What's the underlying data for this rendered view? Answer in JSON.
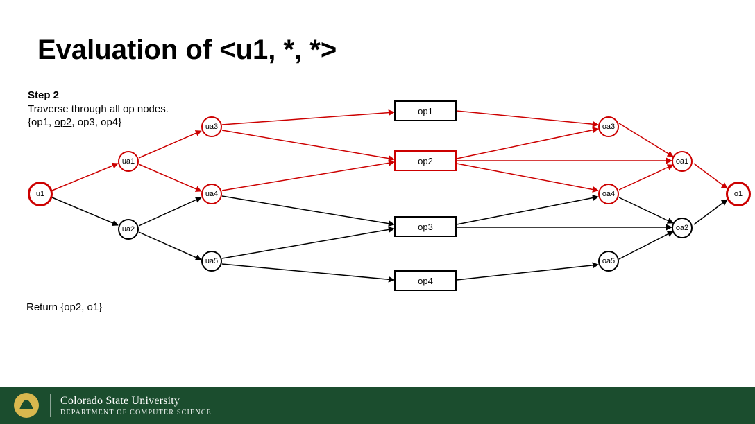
{
  "title": "Evaluation of <u1, *, *>",
  "step": {
    "heading": "Step 2",
    "line1": "Traverse through all op nodes.",
    "line2_prefix": "{op1, ",
    "line2_underlined": "op2",
    "line2_suffix": ", op3, op4}"
  },
  "return_text": "Return {op2, o1}",
  "nodes": {
    "u1": "u1",
    "ua1": "ua1",
    "ua2": "ua2",
    "ua3": "ua3",
    "ua4": "ua4",
    "ua5": "ua5",
    "op1": "op1",
    "op2": "op2",
    "op3": "op3",
    "op4": "op4",
    "oa1": "oa1",
    "oa2": "oa2",
    "oa3": "oa3",
    "oa4": "oa4",
    "oa5": "oa5",
    "o1": "o1"
  },
  "footer": {
    "university": "Colorado State University",
    "department": "DEPARTMENT OF COMPUTER SCIENCE"
  },
  "colors": {
    "red": "#cc0000",
    "black": "#000000",
    "footer": "#1b4d2e"
  },
  "chart_data": {
    "type": "diagram",
    "description": "Directed graph for policy evaluation of <u1,*,*>.",
    "left_nodes": [
      {
        "id": "u1",
        "shape": "circle",
        "color": "red"
      },
      {
        "id": "ua1",
        "shape": "circle",
        "color": "red"
      },
      {
        "id": "ua2",
        "shape": "circle",
        "color": "black"
      },
      {
        "id": "ua3",
        "shape": "circle",
        "color": "red"
      },
      {
        "id": "ua4",
        "shape": "circle",
        "color": "red"
      },
      {
        "id": "ua5",
        "shape": "circle",
        "color": "black"
      }
    ],
    "op_nodes": [
      {
        "id": "op1",
        "shape": "rect",
        "color": "black"
      },
      {
        "id": "op2",
        "shape": "rect",
        "color": "red"
      },
      {
        "id": "op3",
        "shape": "rect",
        "color": "black"
      },
      {
        "id": "op4",
        "shape": "rect",
        "color": "black"
      }
    ],
    "right_nodes": [
      {
        "id": "oa1",
        "shape": "circle",
        "color": "red"
      },
      {
        "id": "oa2",
        "shape": "circle",
        "color": "black"
      },
      {
        "id": "oa3",
        "shape": "circle",
        "color": "red"
      },
      {
        "id": "oa4",
        "shape": "circle",
        "color": "red"
      },
      {
        "id": "oa5",
        "shape": "circle",
        "color": "black"
      },
      {
        "id": "o1",
        "shape": "circle",
        "color": "red"
      }
    ],
    "edges": [
      {
        "from": "u1",
        "to": "ua1",
        "color": "red"
      },
      {
        "from": "u1",
        "to": "ua2",
        "color": "black"
      },
      {
        "from": "ua1",
        "to": "ua3",
        "color": "red"
      },
      {
        "from": "ua1",
        "to": "ua4",
        "color": "red"
      },
      {
        "from": "ua2",
        "to": "ua4",
        "color": "black"
      },
      {
        "from": "ua2",
        "to": "ua5",
        "color": "black"
      },
      {
        "from": "ua3",
        "to": "op1",
        "color": "red"
      },
      {
        "from": "ua3",
        "to": "op2",
        "color": "red"
      },
      {
        "from": "ua4",
        "to": "op2",
        "color": "red"
      },
      {
        "from": "ua4",
        "to": "op3",
        "color": "black"
      },
      {
        "from": "ua5",
        "to": "op3",
        "color": "black"
      },
      {
        "from": "ua5",
        "to": "op4",
        "color": "black"
      },
      {
        "from": "op1",
        "to": "oa3",
        "color": "red"
      },
      {
        "from": "op2",
        "to": "oa3",
        "color": "red"
      },
      {
        "from": "op2",
        "to": "oa1",
        "color": "red"
      },
      {
        "from": "op2",
        "to": "oa4",
        "color": "red"
      },
      {
        "from": "op3",
        "to": "oa4",
        "color": "black"
      },
      {
        "from": "op3",
        "to": "oa2",
        "color": "black"
      },
      {
        "from": "op4",
        "to": "oa5",
        "color": "black"
      },
      {
        "from": "oa3",
        "to": "oa1",
        "color": "red"
      },
      {
        "from": "oa4",
        "to": "oa1",
        "color": "red"
      },
      {
        "from": "oa4",
        "to": "oa2",
        "color": "black"
      },
      {
        "from": "oa5",
        "to": "oa2",
        "color": "black"
      },
      {
        "from": "oa1",
        "to": "o1",
        "color": "red"
      },
      {
        "from": "oa2",
        "to": "o1",
        "color": "black"
      }
    ]
  }
}
